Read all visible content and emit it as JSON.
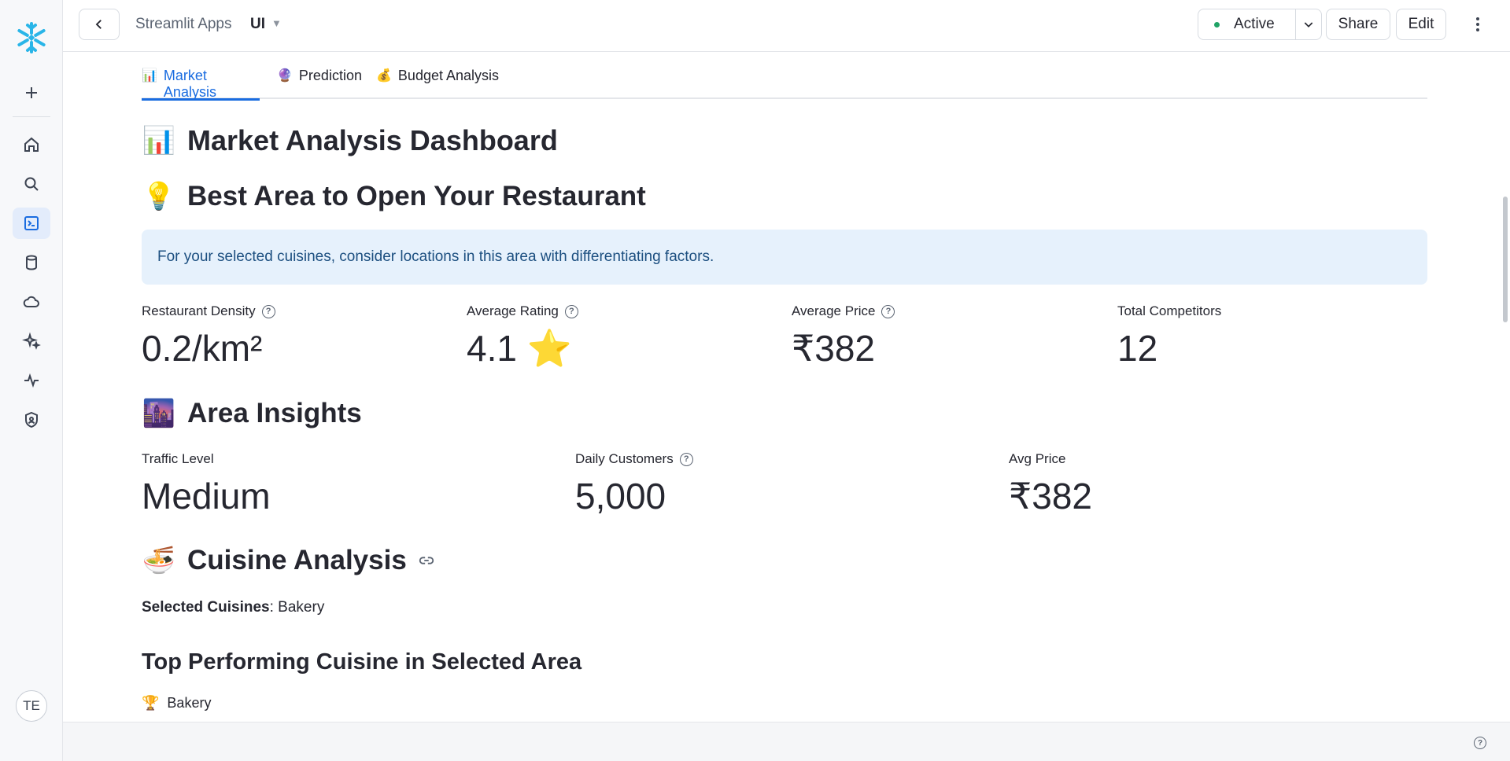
{
  "rail": {
    "items": [
      {
        "name": "plus-icon"
      },
      {
        "name": "home-icon"
      },
      {
        "name": "search-icon"
      },
      {
        "name": "terminal-icon"
      },
      {
        "name": "database-icon"
      },
      {
        "name": "cloud-icon"
      },
      {
        "name": "sparkle-icon"
      },
      {
        "name": "activity-icon"
      },
      {
        "name": "shield-user-icon"
      }
    ],
    "avatar": "TE"
  },
  "topbar": {
    "breadcrumb": "Streamlit Apps",
    "app_name": "UI",
    "status_label": "Active",
    "status_color": "#21a366",
    "share_label": "Share",
    "edit_label": "Edit"
  },
  "tabs": [
    {
      "emoji": "📊",
      "label": "Market Analysis",
      "active": true
    },
    {
      "emoji": "🔮",
      "label": "Prediction",
      "active": false
    },
    {
      "emoji": "💰",
      "label": "Budget Analysis",
      "active": false
    }
  ],
  "page": {
    "title_emoji": "📊",
    "title": "Market Analysis Dashboard",
    "best_area_emoji": "💡",
    "best_area_title": "Best Area to Open Your Restaurant",
    "info_text": "For your selected cuisines, consider locations in this area with differentiating factors.",
    "metrics": [
      {
        "label": "Restaurant Density",
        "value": "0.2/km²",
        "help": true
      },
      {
        "label": "Average Rating",
        "value": "4.1 ⭐",
        "help": true
      },
      {
        "label": "Average Price",
        "value": "₹382",
        "help": true
      },
      {
        "label": "Total Competitors",
        "value": "12",
        "help": false
      }
    ],
    "area_emoji": "🌆",
    "area_title": "Area Insights",
    "area_metrics": [
      {
        "label": "Traffic Level",
        "value": "Medium",
        "help": false
      },
      {
        "label": "Daily Customers",
        "value": "5,000",
        "help": true
      },
      {
        "label": "Avg Price",
        "value": "₹382",
        "help": false
      }
    ],
    "cuisine_emoji": "🍜",
    "cuisine_title": "Cuisine Analysis",
    "selected_label": "Selected Cuisines",
    "selected_value": ": Bakery",
    "top_title": "Top Performing Cuisine in Selected Area",
    "top_emoji": "🏆",
    "top_item": "Bakery"
  },
  "colors": {
    "accent": "#1a6ce0",
    "info_bg": "#e6f1fc",
    "info_text": "#1c4f80"
  }
}
